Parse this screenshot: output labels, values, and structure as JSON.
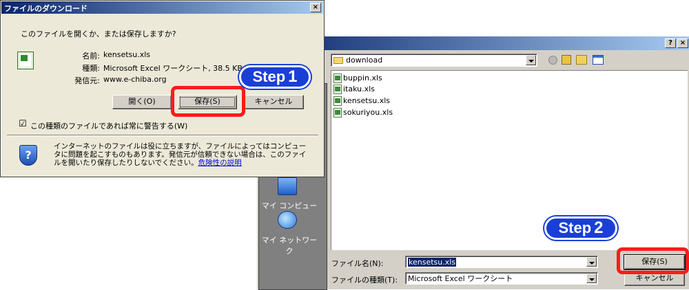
{
  "download_dialog": {
    "title": "ファイルのダウンロード",
    "close_label": "×",
    "question": "このファイルを開くか、または保存しますか?",
    "name_label": "名前:",
    "name_value": "kensetsu.xls",
    "type_label": "種類:",
    "type_value": "Microsoft Excel ワークシート, 38.5 KB",
    "from_label": "発信元:",
    "from_value": "www.e-chiba.org",
    "open_button": "開く(O)",
    "save_button": "保存(S)",
    "cancel_button": "キャンセル",
    "checkbox_mark": "☑",
    "checkbox_label": "この種類のファイルであれば常に警告する(W)",
    "warning_text": "インターネットのファイルは役に立ちますが、ファイルによってはコンピュータに問題を起こすものもあります。発信元が信頼できない場合は、このファイルを開いたり保存したりしないでください。",
    "warning_link": "危険性の説明"
  },
  "save_dialog": {
    "help_label": "?",
    "close_label": "×",
    "location": "download",
    "files": [
      "buppin.xls",
      "itaku.xls",
      "kensetsu.xls",
      "sokuriyou.xls"
    ],
    "places": [
      "マイ コンピュータ",
      "マイ ネットワーク"
    ],
    "filename_label": "ファイル名(N):",
    "filename_value": "kensetsu.xls",
    "filetype_label": "ファイルの種類(T):",
    "filetype_value": "Microsoft Excel ワークシート",
    "save_button": "保存(S)",
    "cancel_button": "キャンセル"
  },
  "steps": {
    "step1_word": "Step",
    "step1_num": "1",
    "step2_word": "Step",
    "step2_num": "2"
  },
  "colors": {
    "title_gradient_start": "#0a246a",
    "title_gradient_end": "#a6caf0",
    "dialog_bg": "#ece9d8",
    "highlight_red": "#ff1a1a",
    "step_blue": "#1a3fd6"
  }
}
